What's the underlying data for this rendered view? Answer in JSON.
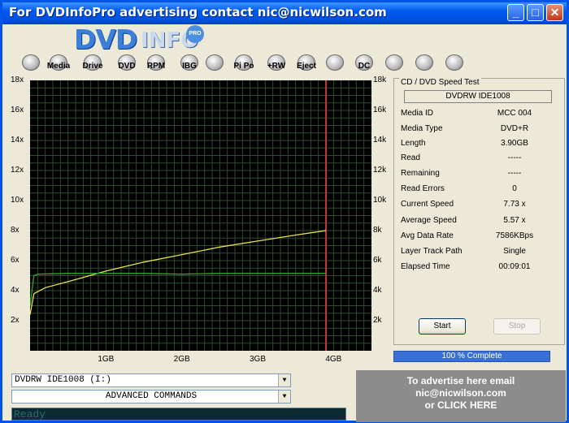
{
  "window": {
    "title": "For DVDInfoPro advertising contact nic@nicwilson.com"
  },
  "logo": {
    "dvd": "DVD",
    "info": "INFO",
    "pro": "PRO"
  },
  "toolbar": {
    "items": [
      {
        "label": "",
        "icon": "monitor-icon"
      },
      {
        "label": "Media",
        "icon": "media-icon"
      },
      {
        "label": "Drive",
        "icon": "drive-icon"
      },
      {
        "label": "DVD",
        "icon": "dvd-disc-icon"
      },
      {
        "label": "RPM",
        "icon": "rpm-icon"
      },
      {
        "label": "IBG",
        "icon": "ibg-icon"
      },
      {
        "label": "",
        "icon": "magnifier-icon"
      },
      {
        "label": "Pi Po",
        "icon": "pipo-icon"
      },
      {
        "label": "+RW",
        "icon": "rw-icon"
      },
      {
        "label": "Eject",
        "icon": "eject-icon"
      },
      {
        "label": "",
        "icon": "tools-icon"
      },
      {
        "label": "DC",
        "icon": "dc-icon"
      },
      {
        "label": "",
        "icon": "clipboard-icon"
      },
      {
        "label": "",
        "icon": "camera-icon"
      },
      {
        "label": "",
        "icon": "notepad-icon"
      }
    ]
  },
  "chart_data": {
    "type": "line",
    "x_ticks": [
      "1GB",
      "2GB",
      "3GB",
      "4GB"
    ],
    "y_ticks_left": [
      "2x",
      "4x",
      "6x",
      "8x",
      "10x",
      "12x",
      "14x",
      "16x",
      "18x"
    ],
    "y_ticks_right": [
      "2k",
      "4k",
      "6k",
      "8k",
      "10k",
      "12k",
      "14k",
      "16k",
      "18k"
    ],
    "xlim": [
      0,
      4.5
    ],
    "ylim": [
      0,
      18
    ],
    "grid": true,
    "marker_x": 3.9,
    "series": [
      {
        "color": "#e6e34a",
        "x": [
          0,
          0.05,
          0.2,
          0.5,
          1.0,
          1.5,
          2.0,
          2.5,
          3.0,
          3.5,
          3.9
        ],
        "y": [
          2.4,
          3.8,
          4.2,
          4.6,
          5.3,
          5.9,
          6.4,
          6.9,
          7.3,
          7.7,
          8.0
        ]
      },
      {
        "color": "#2fa52f",
        "x": [
          0,
          0.05,
          0.1,
          0.5,
          1.0,
          1.5,
          2.0,
          2.5,
          3.0,
          3.5,
          3.9
        ],
        "y": [
          3.0,
          5.0,
          5.1,
          5.15,
          5.15,
          5.15,
          5.1,
          5.15,
          5.15,
          5.15,
          5.15
        ]
      }
    ]
  },
  "panel": {
    "title": "CD / DVD Speed Test",
    "drive": "DVDRW   IDE1008",
    "rows": [
      {
        "key": "Media ID",
        "value": "MCC    004"
      },
      {
        "key": "Media Type",
        "value": "DVD+R"
      },
      {
        "key": "Length",
        "value": "3.90GB"
      },
      {
        "key": "Read",
        "value": "-----"
      },
      {
        "key": "Remaining",
        "value": "-----"
      },
      {
        "key": "Read Errors",
        "value": "0"
      },
      {
        "key": "Current Speed",
        "value": "7.73 x"
      },
      {
        "key": "Average Speed",
        "value": "5.57 x"
      },
      {
        "key": "Avg Data Rate",
        "value": "7586KBps"
      },
      {
        "key": "Layer Track Path",
        "value": "Single"
      },
      {
        "key": "Elapsed Time",
        "value": "00:09:01"
      }
    ],
    "start_label": "Start",
    "stop_label": "Stop"
  },
  "progress": {
    "label": "100 % Complete",
    "value": 1.0
  },
  "drive_select": {
    "value": "DVDRW   IDE1008 (I:)"
  },
  "commands_select": {
    "value": "ADVANCED COMMANDS"
  },
  "status": {
    "text": "Ready"
  },
  "ad": {
    "line1": "To advertise here email",
    "line2": "nic@nicwilson.com",
    "line3": "or CLICK HERE"
  }
}
